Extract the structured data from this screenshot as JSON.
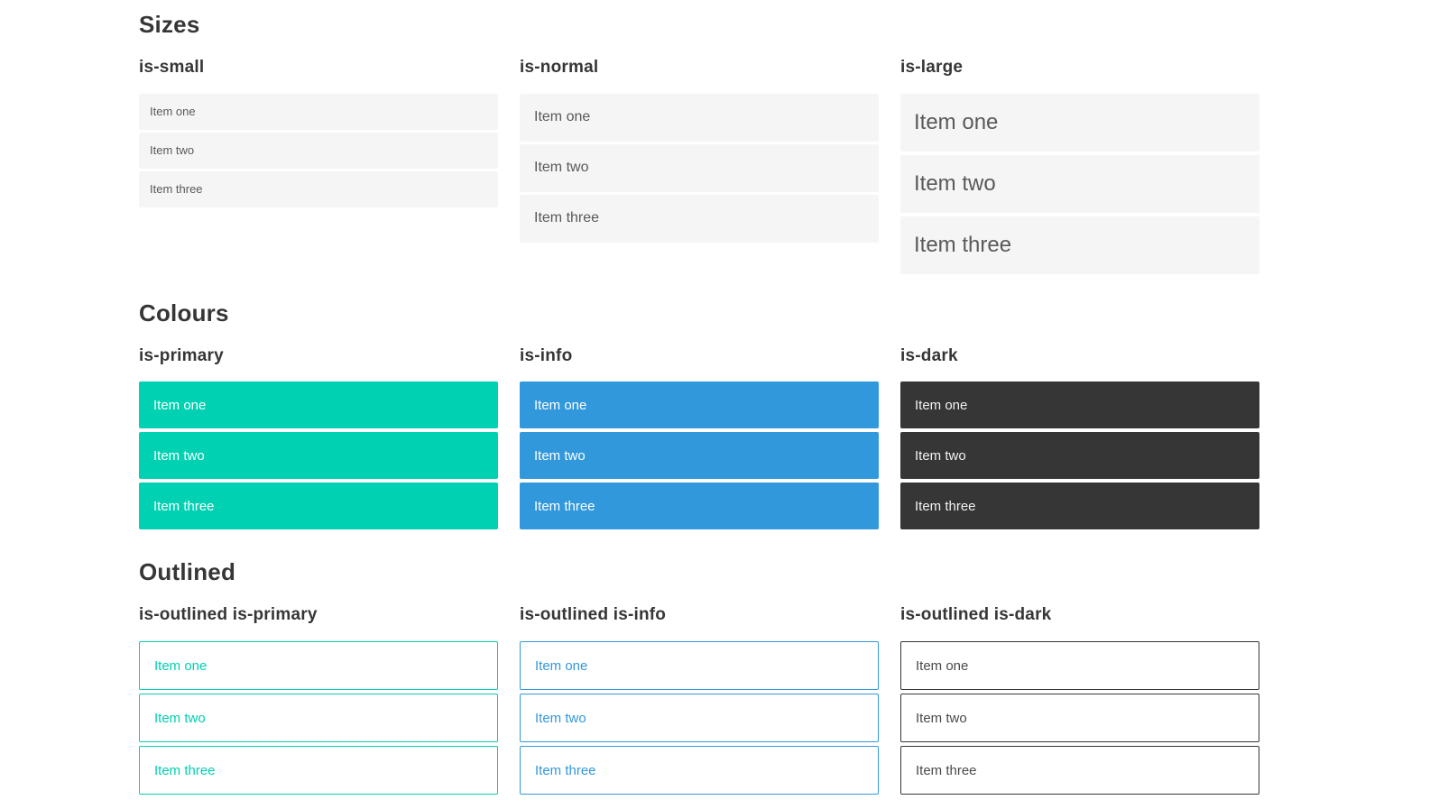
{
  "colors": {
    "primary": "#00d1b2",
    "info": "#3298dc",
    "dark": "#363636",
    "item_background": "#f5f5f5",
    "item_text": "#595959",
    "heading_text": "#363636",
    "outlined_dark_text": "#4a4a4a",
    "page_background": "#ffffff"
  },
  "sections": [
    {
      "id": "sizes",
      "title": "Sizes",
      "columns": [
        {
          "header": "is-small",
          "variant": "small",
          "items": [
            "Item one",
            "Item two",
            "Item three"
          ]
        },
        {
          "header": "is-normal",
          "variant": "normal",
          "items": [
            "Item one",
            "Item two",
            "Item three"
          ]
        },
        {
          "header": "is-large",
          "variant": "large",
          "items": [
            "Item one",
            "Item two",
            "Item three"
          ]
        }
      ]
    },
    {
      "id": "colours",
      "title": "Colours",
      "columns": [
        {
          "header": "is-primary",
          "variant": "primary",
          "items": [
            "Item one",
            "Item two",
            "Item three"
          ]
        },
        {
          "header": "is-info",
          "variant": "info",
          "items": [
            "Item one",
            "Item two",
            "Item three"
          ]
        },
        {
          "header": "is-dark",
          "variant": "dark",
          "items": [
            "Item one",
            "Item two",
            "Item three"
          ]
        }
      ]
    },
    {
      "id": "outlined",
      "title": "Outlined",
      "columns": [
        {
          "header": "is-outlined is-primary",
          "variant": "outlined-primary",
          "items": [
            "Item one",
            "Item two",
            "Item three"
          ]
        },
        {
          "header": "is-outlined is-info",
          "variant": "outlined-info",
          "items": [
            "Item one",
            "Item two",
            "Item three"
          ]
        },
        {
          "header": "is-outlined is-dark",
          "variant": "outlined-dark",
          "items": [
            "Item one",
            "Item two",
            "Item three"
          ]
        }
      ]
    }
  ]
}
